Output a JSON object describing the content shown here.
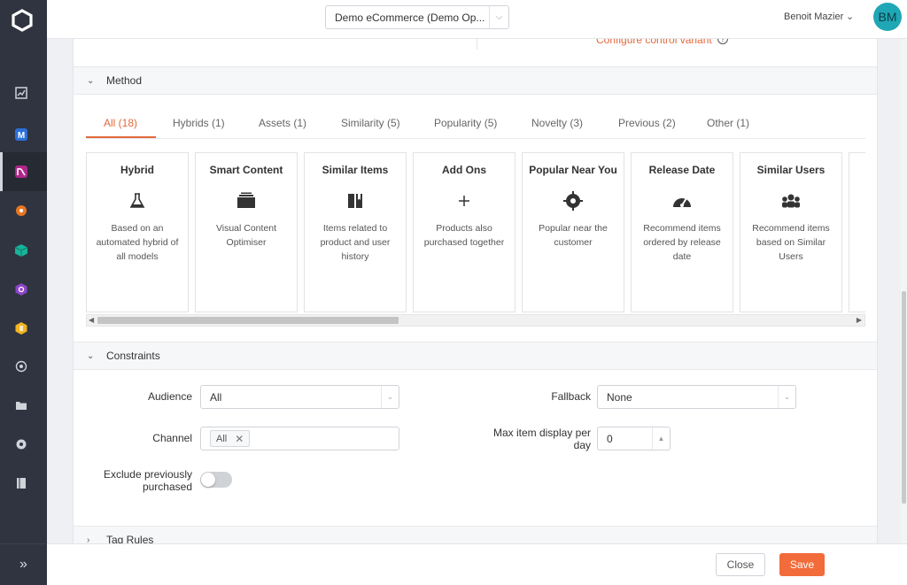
{
  "topbar": {
    "account": "Demo eCommerce (Demo Op...",
    "user_name": "Benoit Mazier",
    "avatar_initials": "BM"
  },
  "previous_section": {
    "link": "Configure control variant"
  },
  "method": {
    "title": "Method",
    "tabs": [
      {
        "label": "All (18)",
        "active": true
      },
      {
        "label": "Hybrids (1)",
        "active": false
      },
      {
        "label": "Assets (1)",
        "active": false
      },
      {
        "label": "Similarity (5)",
        "active": false
      },
      {
        "label": "Popularity (5)",
        "active": false
      },
      {
        "label": "Novelty (3)",
        "active": false
      },
      {
        "label": "Previous (2)",
        "active": false
      },
      {
        "label": "Other (1)",
        "active": false
      }
    ],
    "cards": [
      {
        "name": "Hybrid",
        "icon": "flask-icon",
        "desc": "Based on an automated hybrid of all models"
      },
      {
        "name": "Smart Content",
        "icon": "content-stack-icon",
        "desc": "Visual Content Optimiser"
      },
      {
        "name": "Similar Items",
        "icon": "book-icon",
        "desc": "Items related to product and user history"
      },
      {
        "name": "Add Ons",
        "icon": "plus-icon",
        "desc": "Products also purchased together"
      },
      {
        "name": "Popular Near You",
        "icon": "location-target-icon",
        "desc": "Popular near the customer"
      },
      {
        "name": "Release Date",
        "icon": "speedometer-icon",
        "desc": "Recommend items ordered by release date"
      },
      {
        "name": "Similar Users",
        "icon": "users-group-icon",
        "desc": "Recommend items based on Similar Users"
      }
    ]
  },
  "constraints": {
    "title": "Constraints",
    "audience_label": "Audience",
    "audience_value": "All",
    "fallback_label": "Fallback",
    "fallback_value": "None",
    "channel_label": "Channel",
    "channel_tag": "All",
    "max_item_label": "Max item display per day",
    "max_item_value": "0",
    "exclude_label": "Exclude previously purchased",
    "exclude_enabled": false
  },
  "tag_rules": {
    "title": "Tag Rules"
  },
  "footer": {
    "close_label": "Close",
    "save_label": "Save"
  },
  "colors": {
    "accent": "#f26b3a",
    "sidebar": "#2f3440",
    "avatar": "#1fa7b5"
  }
}
